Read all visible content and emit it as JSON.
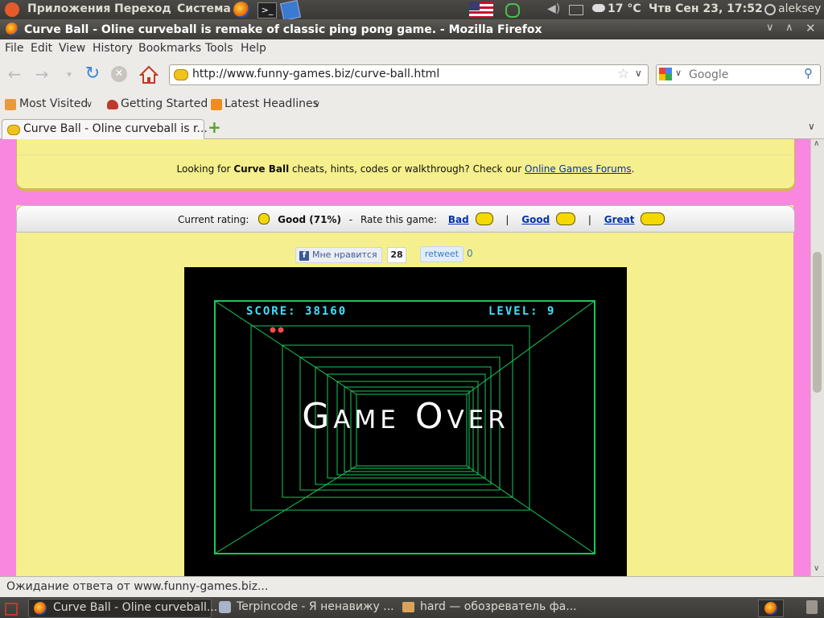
{
  "panel": {
    "menus": [
      "Приложения",
      "Переход",
      "Система"
    ],
    "temperature": "17 °C",
    "datetime": "Чтв Сен 23, 17:52",
    "user": "aleksey"
  },
  "window": {
    "title": "Curve Ball - Oline curveball is remake of classic ping pong game. - Mozilla Firefox"
  },
  "menubar": [
    "File",
    "Edit",
    "View",
    "History",
    "Bookmarks",
    "Tools",
    "Help"
  ],
  "navigation": {
    "url": "http://www.funny-games.biz/curve-ball.html",
    "search_placeholder": "Google"
  },
  "bookmarks": [
    "Most Visited",
    "Getting Started",
    "Latest Headlines"
  ],
  "tab": {
    "label": "Curve Ball - Oline curveball is r..."
  },
  "page": {
    "cheats": {
      "prefix": "Looking for",
      "game": "Curve Ball",
      "middle": "cheats, hints, codes or walkthrough? Check our",
      "link": "Online Games Forums",
      "suffix": "."
    },
    "rating": {
      "label": "Current rating:",
      "value": "Good (71%)",
      "dash": "-",
      "rate_label": "Rate this game:",
      "bad": "Bad",
      "good": "Good",
      "great": "Great",
      "sep": "|"
    },
    "social": {
      "like": "Мне нравится",
      "like_count": "28",
      "retweet": "retweet",
      "retweet_count": "0"
    },
    "game": {
      "score_label": "SCORE:",
      "score": "38160",
      "level_label": "LEVEL:",
      "level": "9",
      "message": "Game Over",
      "lives": 2
    }
  },
  "status": {
    "text": "Ожидание ответа от www.funny-games.biz..."
  },
  "taskbar": [
    "Curve Ball - Oline curveball...",
    "Terpincode - Я ненавижу ...",
    "hard — обозреватель фа..."
  ]
}
